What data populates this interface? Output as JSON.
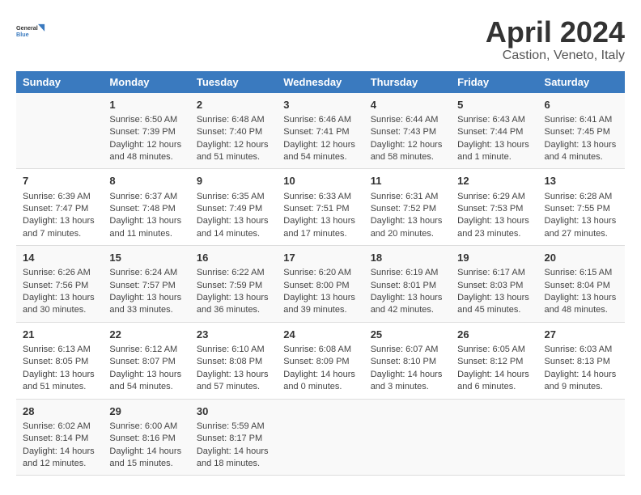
{
  "logo": {
    "line1": "General",
    "line2": "Blue"
  },
  "title": "April 2024",
  "subtitle": "Castion, Veneto, Italy",
  "weekdays": [
    "Sunday",
    "Monday",
    "Tuesday",
    "Wednesday",
    "Thursday",
    "Friday",
    "Saturday"
  ],
  "weeks": [
    [
      {
        "date": "",
        "sunrise": "",
        "sunset": "",
        "daylight": ""
      },
      {
        "date": "1",
        "sunrise": "Sunrise: 6:50 AM",
        "sunset": "Sunset: 7:39 PM",
        "daylight": "Daylight: 12 hours and 48 minutes."
      },
      {
        "date": "2",
        "sunrise": "Sunrise: 6:48 AM",
        "sunset": "Sunset: 7:40 PM",
        "daylight": "Daylight: 12 hours and 51 minutes."
      },
      {
        "date": "3",
        "sunrise": "Sunrise: 6:46 AM",
        "sunset": "Sunset: 7:41 PM",
        "daylight": "Daylight: 12 hours and 54 minutes."
      },
      {
        "date": "4",
        "sunrise": "Sunrise: 6:44 AM",
        "sunset": "Sunset: 7:43 PM",
        "daylight": "Daylight: 12 hours and 58 minutes."
      },
      {
        "date": "5",
        "sunrise": "Sunrise: 6:43 AM",
        "sunset": "Sunset: 7:44 PM",
        "daylight": "Daylight: 13 hours and 1 minute."
      },
      {
        "date": "6",
        "sunrise": "Sunrise: 6:41 AM",
        "sunset": "Sunset: 7:45 PM",
        "daylight": "Daylight: 13 hours and 4 minutes."
      }
    ],
    [
      {
        "date": "7",
        "sunrise": "Sunrise: 6:39 AM",
        "sunset": "Sunset: 7:47 PM",
        "daylight": "Daylight: 13 hours and 7 minutes."
      },
      {
        "date": "8",
        "sunrise": "Sunrise: 6:37 AM",
        "sunset": "Sunset: 7:48 PM",
        "daylight": "Daylight: 13 hours and 11 minutes."
      },
      {
        "date": "9",
        "sunrise": "Sunrise: 6:35 AM",
        "sunset": "Sunset: 7:49 PM",
        "daylight": "Daylight: 13 hours and 14 minutes."
      },
      {
        "date": "10",
        "sunrise": "Sunrise: 6:33 AM",
        "sunset": "Sunset: 7:51 PM",
        "daylight": "Daylight: 13 hours and 17 minutes."
      },
      {
        "date": "11",
        "sunrise": "Sunrise: 6:31 AM",
        "sunset": "Sunset: 7:52 PM",
        "daylight": "Daylight: 13 hours and 20 minutes."
      },
      {
        "date": "12",
        "sunrise": "Sunrise: 6:29 AM",
        "sunset": "Sunset: 7:53 PM",
        "daylight": "Daylight: 13 hours and 23 minutes."
      },
      {
        "date": "13",
        "sunrise": "Sunrise: 6:28 AM",
        "sunset": "Sunset: 7:55 PM",
        "daylight": "Daylight: 13 hours and 27 minutes."
      }
    ],
    [
      {
        "date": "14",
        "sunrise": "Sunrise: 6:26 AM",
        "sunset": "Sunset: 7:56 PM",
        "daylight": "Daylight: 13 hours and 30 minutes."
      },
      {
        "date": "15",
        "sunrise": "Sunrise: 6:24 AM",
        "sunset": "Sunset: 7:57 PM",
        "daylight": "Daylight: 13 hours and 33 minutes."
      },
      {
        "date": "16",
        "sunrise": "Sunrise: 6:22 AM",
        "sunset": "Sunset: 7:59 PM",
        "daylight": "Daylight: 13 hours and 36 minutes."
      },
      {
        "date": "17",
        "sunrise": "Sunrise: 6:20 AM",
        "sunset": "Sunset: 8:00 PM",
        "daylight": "Daylight: 13 hours and 39 minutes."
      },
      {
        "date": "18",
        "sunrise": "Sunrise: 6:19 AM",
        "sunset": "Sunset: 8:01 PM",
        "daylight": "Daylight: 13 hours and 42 minutes."
      },
      {
        "date": "19",
        "sunrise": "Sunrise: 6:17 AM",
        "sunset": "Sunset: 8:03 PM",
        "daylight": "Daylight: 13 hours and 45 minutes."
      },
      {
        "date": "20",
        "sunrise": "Sunrise: 6:15 AM",
        "sunset": "Sunset: 8:04 PM",
        "daylight": "Daylight: 13 hours and 48 minutes."
      }
    ],
    [
      {
        "date": "21",
        "sunrise": "Sunrise: 6:13 AM",
        "sunset": "Sunset: 8:05 PM",
        "daylight": "Daylight: 13 hours and 51 minutes."
      },
      {
        "date": "22",
        "sunrise": "Sunrise: 6:12 AM",
        "sunset": "Sunset: 8:07 PM",
        "daylight": "Daylight: 13 hours and 54 minutes."
      },
      {
        "date": "23",
        "sunrise": "Sunrise: 6:10 AM",
        "sunset": "Sunset: 8:08 PM",
        "daylight": "Daylight: 13 hours and 57 minutes."
      },
      {
        "date": "24",
        "sunrise": "Sunrise: 6:08 AM",
        "sunset": "Sunset: 8:09 PM",
        "daylight": "Daylight: 14 hours and 0 minutes."
      },
      {
        "date": "25",
        "sunrise": "Sunrise: 6:07 AM",
        "sunset": "Sunset: 8:10 PM",
        "daylight": "Daylight: 14 hours and 3 minutes."
      },
      {
        "date": "26",
        "sunrise": "Sunrise: 6:05 AM",
        "sunset": "Sunset: 8:12 PM",
        "daylight": "Daylight: 14 hours and 6 minutes."
      },
      {
        "date": "27",
        "sunrise": "Sunrise: 6:03 AM",
        "sunset": "Sunset: 8:13 PM",
        "daylight": "Daylight: 14 hours and 9 minutes."
      }
    ],
    [
      {
        "date": "28",
        "sunrise": "Sunrise: 6:02 AM",
        "sunset": "Sunset: 8:14 PM",
        "daylight": "Daylight: 14 hours and 12 minutes."
      },
      {
        "date": "29",
        "sunrise": "Sunrise: 6:00 AM",
        "sunset": "Sunset: 8:16 PM",
        "daylight": "Daylight: 14 hours and 15 minutes."
      },
      {
        "date": "30",
        "sunrise": "Sunrise: 5:59 AM",
        "sunset": "Sunset: 8:17 PM",
        "daylight": "Daylight: 14 hours and 18 minutes."
      },
      {
        "date": "",
        "sunrise": "",
        "sunset": "",
        "daylight": ""
      },
      {
        "date": "",
        "sunrise": "",
        "sunset": "",
        "daylight": ""
      },
      {
        "date": "",
        "sunrise": "",
        "sunset": "",
        "daylight": ""
      },
      {
        "date": "",
        "sunrise": "",
        "sunset": "",
        "daylight": ""
      }
    ]
  ]
}
